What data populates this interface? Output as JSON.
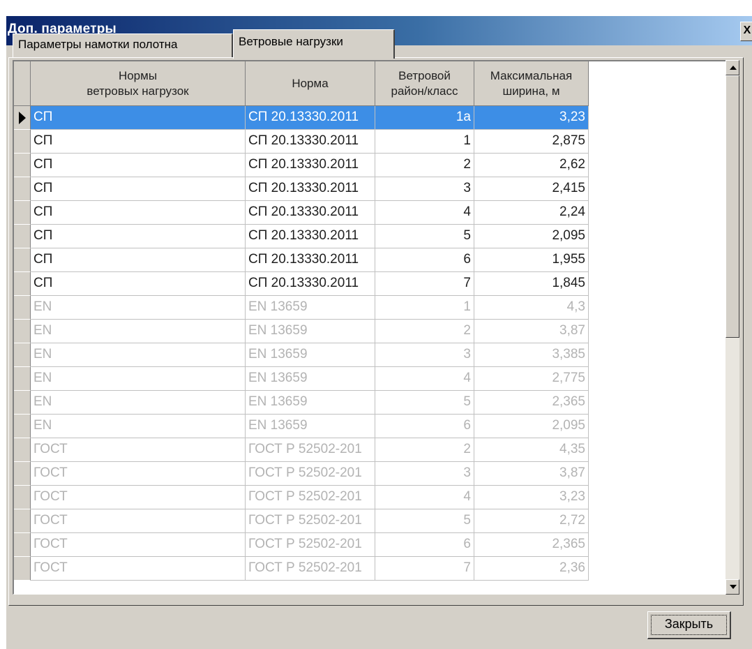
{
  "window": {
    "title": "Доп. параметры",
    "close_glyph": "X"
  },
  "tabs": [
    {
      "label": "Параметры намотки полотна",
      "active": false
    },
    {
      "label": "Ветровые нагрузки",
      "active": true
    }
  ],
  "grid": {
    "columns": [
      {
        "label": "Нормы\nветровых нагрузок"
      },
      {
        "label": "Норма"
      },
      {
        "label": "Ветровой\nрайон/класс"
      },
      {
        "label": "Максимальная\nширина, м"
      }
    ],
    "selected_index": 0,
    "rows": [
      {
        "standard": "СП",
        "norm": "СП 20.13330.2011",
        "region": "1а",
        "max_width": "3,23",
        "enabled": true
      },
      {
        "standard": "СП",
        "norm": "СП 20.13330.2011",
        "region": "1",
        "max_width": "2,875",
        "enabled": true
      },
      {
        "standard": "СП",
        "norm": "СП 20.13330.2011",
        "region": "2",
        "max_width": "2,62",
        "enabled": true
      },
      {
        "standard": "СП",
        "norm": "СП 20.13330.2011",
        "region": "3",
        "max_width": "2,415",
        "enabled": true
      },
      {
        "standard": "СП",
        "norm": "СП 20.13330.2011",
        "region": "4",
        "max_width": "2,24",
        "enabled": true
      },
      {
        "standard": "СП",
        "norm": "СП 20.13330.2011",
        "region": "5",
        "max_width": "2,095",
        "enabled": true
      },
      {
        "standard": "СП",
        "norm": "СП 20.13330.2011",
        "region": "6",
        "max_width": "1,955",
        "enabled": true
      },
      {
        "standard": "СП",
        "norm": "СП 20.13330.2011",
        "region": "7",
        "max_width": "1,845",
        "enabled": true
      },
      {
        "standard": "EN",
        "norm": "EN 13659",
        "region": "1",
        "max_width": "4,3",
        "enabled": false
      },
      {
        "standard": "EN",
        "norm": "EN 13659",
        "region": "2",
        "max_width": "3,87",
        "enabled": false
      },
      {
        "standard": "EN",
        "norm": "EN 13659",
        "region": "3",
        "max_width": "3,385",
        "enabled": false
      },
      {
        "standard": "EN",
        "norm": "EN 13659",
        "region": "4",
        "max_width": "2,775",
        "enabled": false
      },
      {
        "standard": "EN",
        "norm": "EN 13659",
        "region": "5",
        "max_width": "2,365",
        "enabled": false
      },
      {
        "standard": "EN",
        "norm": "EN 13659",
        "region": "6",
        "max_width": "2,095",
        "enabled": false
      },
      {
        "standard": "ГОСТ",
        "norm": "ГОСТ Р 52502-201",
        "region": "2",
        "max_width": "4,35",
        "enabled": false
      },
      {
        "standard": "ГОСТ",
        "norm": "ГОСТ Р 52502-201",
        "region": "3",
        "max_width": "3,87",
        "enabled": false
      },
      {
        "standard": "ГОСТ",
        "norm": "ГОСТ Р 52502-201",
        "region": "4",
        "max_width": "3,23",
        "enabled": false
      },
      {
        "standard": "ГОСТ",
        "norm": "ГОСТ Р 52502-201",
        "region": "5",
        "max_width": "2,72",
        "enabled": false
      },
      {
        "standard": "ГОСТ",
        "norm": "ГОСТ Р 52502-201",
        "region": "6",
        "max_width": "2,365",
        "enabled": false
      },
      {
        "standard": "ГОСТ",
        "norm": "ГОСТ Р 52502-201",
        "region": "7",
        "max_width": "2,36",
        "enabled": false
      }
    ]
  },
  "footer": {
    "close_label": "Закрыть"
  }
}
